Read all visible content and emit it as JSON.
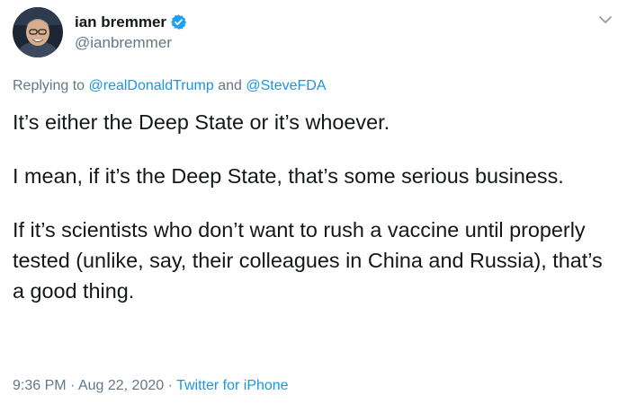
{
  "author": {
    "display_name": "ian bremmer",
    "handle": "@ianbremmer",
    "verified": true
  },
  "icons": {
    "avatar": "avatar",
    "verified": "verified-badge-icon",
    "menu": "chevron-down-icon"
  },
  "reply": {
    "prefix": "Replying to",
    "mention1": "@realDonaldTrump",
    "conjunction": "and",
    "mention2": "@SteveFDA"
  },
  "body": {
    "p1": "It’s either the Deep State or it’s whoever.",
    "p2": "I mean, if it’s the Deep State, that’s some serious business.",
    "p3": "If it’s scientists who don’t want to rush a vaccine until properly tested (unlike, say, their colleagues in China and Russia), that’s a good thing."
  },
  "meta": {
    "time": "9:36 PM",
    "separator": "·",
    "date": "Aug 22, 2020",
    "source": "Twitter for iPhone"
  },
  "colors": {
    "link": "#1b95e0",
    "secondary_text": "#657786",
    "primary_text": "#14171a"
  }
}
